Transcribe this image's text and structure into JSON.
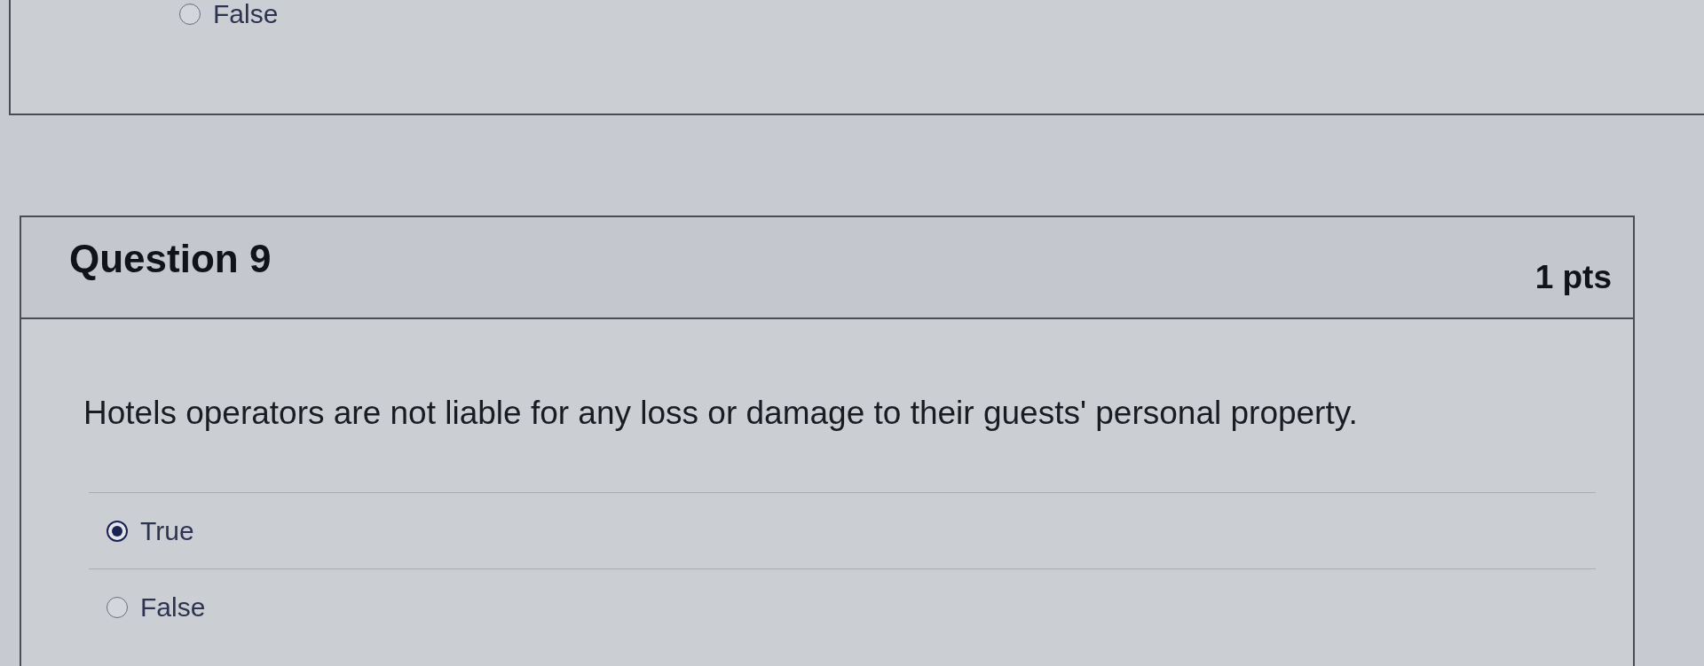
{
  "previous_question": {
    "options": [
      {
        "label": "False",
        "selected": false
      }
    ]
  },
  "question": {
    "title": "Question 9",
    "points": "1 pts",
    "text": "Hotels operators are not liable for any loss or damage to their guests' personal property.",
    "options": [
      {
        "label": "True",
        "selected": true
      },
      {
        "label": "False",
        "selected": false
      }
    ]
  }
}
